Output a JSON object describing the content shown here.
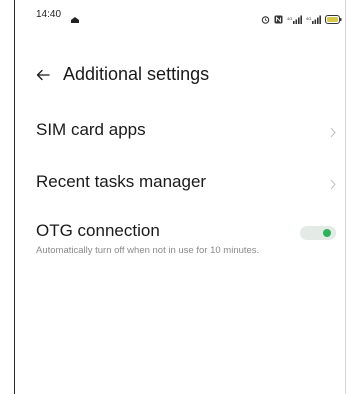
{
  "status_bar": {
    "time": "14:40",
    "icons": [
      "notification-icon",
      "alarm-icon",
      "nfc-icon",
      "signal-icon",
      "signal-icon",
      "battery-icon"
    ]
  },
  "header": {
    "back_icon": "arrow-left-icon",
    "title": "Additional settings"
  },
  "settings": {
    "sim_card_apps": {
      "label": "SIM card apps",
      "icon": "chevron-right-icon"
    },
    "recent_tasks_manager": {
      "label": "Recent tasks manager",
      "icon": "chevron-right-icon"
    },
    "otg_connection": {
      "label": "OTG connection",
      "description": "Automatically turn off when not in use for 10 minutes.",
      "enabled": true
    }
  },
  "colors": {
    "accent": "#2fb35a",
    "toggle_track": "#e4ebe6",
    "text_primary": "#1a1a1a",
    "text_secondary": "#8a8a8a",
    "chevron": "#c4c4c4"
  }
}
